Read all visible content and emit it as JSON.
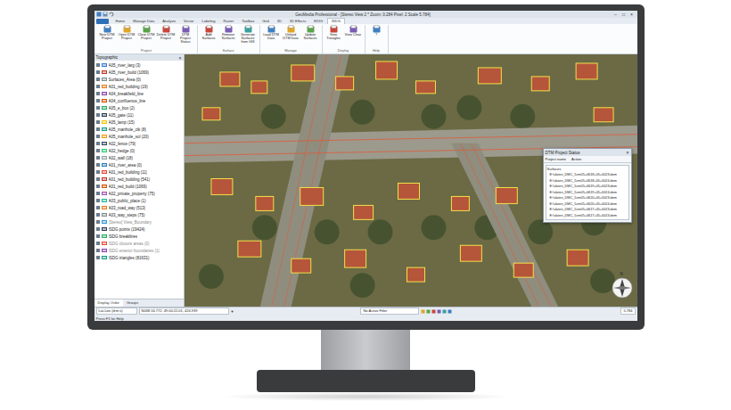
{
  "window": {
    "title": "GeoMedia Professional - [Stereo View 2 * Zoom: 0.284 Pixel: 2 Scale 5.784]",
    "controls": [
      "–",
      "□",
      "×"
    ]
  },
  "ribbon_tabs": [
    {
      "label": "Home",
      "selected": false
    },
    {
      "label": "Manage Data",
      "selected": false
    },
    {
      "label": "Analysis",
      "selected": false
    },
    {
      "label": "Vector",
      "selected": false
    },
    {
      "label": "Labeling",
      "selected": false
    },
    {
      "label": "Raster",
      "selected": false
    },
    {
      "label": "Toolbox",
      "selected": false
    },
    {
      "label": "Grid",
      "selected": false
    },
    {
      "label": "3D",
      "selected": false
    },
    {
      "label": "3D Effects",
      "selected": false
    },
    {
      "label": "EDIG",
      "selected": false
    },
    {
      "label": "ISDG",
      "selected": true
    }
  ],
  "ribbon_groups": [
    {
      "label": "Project",
      "buttons": [
        "New DTM Project",
        "Open DTM Project",
        "Close DTM Project",
        "Delete DTM Project",
        "DTM Project Status"
      ]
    },
    {
      "label": "Surface",
      "buttons": [
        "Add Surfaces",
        "Remove Surfaces",
        "Generate Surfaces from GIS"
      ]
    },
    {
      "label": "Manage",
      "buttons": [
        "Load DTM Data",
        "Unload DTM Data",
        "Update Surfaces"
      ]
    },
    {
      "label": "Display",
      "buttons": [
        "View Triangles",
        "View Clear"
      ]
    },
    {
      "label": "Help",
      "buttons": [
        "?"
      ]
    }
  ],
  "legend": {
    "title": "Topographic",
    "close": "×",
    "items": [
      {
        "label": "A05_river_larg (3)",
        "checked": true,
        "disabled": false,
        "color": "#3a7bd5"
      },
      {
        "label": "A05_river_build (1069)",
        "checked": true,
        "disabled": false,
        "color": "#c0392b"
      },
      {
        "label": "Surfaces_Area (0)",
        "checked": true,
        "disabled": false,
        "color": "#7f8c8d"
      },
      {
        "label": "A01_red_building (19)",
        "checked": true,
        "disabled": false,
        "color": "#e67e22"
      },
      {
        "label": "A04_breakfield_line",
        "checked": true,
        "disabled": false,
        "color": "#8e44ad"
      },
      {
        "label": "A04_confluence_line",
        "checked": true,
        "disabled": false,
        "color": "#d35400"
      },
      {
        "label": "A05_e_box (2)",
        "checked": true,
        "disabled": false,
        "color": "#27ae60"
      },
      {
        "label": "A05_gate (11)",
        "checked": true,
        "disabled": false,
        "color": "#2c3e50"
      },
      {
        "label": "A05_lamp (15)",
        "checked": true,
        "disabled": false,
        "color": "#f1c40f"
      },
      {
        "label": "A05_manhole_cik (8)",
        "checked": true,
        "disabled": false,
        "color": "#16a085"
      },
      {
        "label": "A05_manhole_sol (20)",
        "checked": true,
        "disabled": false,
        "color": "#f39c12"
      },
      {
        "label": "A02_fence (79)",
        "checked": true,
        "disabled": false,
        "color": "#34495e"
      },
      {
        "label": "A02_hedge (0)",
        "checked": true,
        "disabled": false,
        "color": "#2ecc71"
      },
      {
        "label": "A02_wall (18)",
        "checked": true,
        "disabled": false,
        "color": "#95a5a6"
      },
      {
        "label": "A01_river_area (0)",
        "checked": true,
        "disabled": false,
        "color": "#2980b9"
      },
      {
        "label": "A01_red_building (11)",
        "checked": true,
        "disabled": false,
        "color": "#e74c3c"
      },
      {
        "label": "A01_red_building (541)",
        "checked": true,
        "disabled": false,
        "color": "#c0392b"
      },
      {
        "label": "A01_red_build (1069)",
        "checked": true,
        "disabled": false,
        "color": "#d35400"
      },
      {
        "label": "A02_private_property (75)",
        "checked": true,
        "disabled": false,
        "color": "#9b59b6"
      },
      {
        "label": "A03_public_place (1)",
        "checked": true,
        "disabled": false,
        "color": "#1abc9c"
      },
      {
        "label": "A03_road_way (513)",
        "checked": true,
        "disabled": false,
        "color": "#e67e22"
      },
      {
        "label": "A03_way_steps (75)",
        "checked": true,
        "disabled": false,
        "color": "#7f8c8d"
      },
      {
        "label": "[Stereo] View_Boundary",
        "checked": true,
        "disabled": true,
        "color": "#3498db"
      },
      {
        "label": "ISDG points (19424)",
        "checked": true,
        "disabled": false,
        "color": "#2c3e50"
      },
      {
        "label": "ISDG breaklines",
        "checked": true,
        "disabled": false,
        "color": "#27ae60"
      },
      {
        "label": "ISDG closure areas (0)",
        "checked": true,
        "disabled": true,
        "color": "#e74c3c"
      },
      {
        "label": "ISDG exterior boundaries (1)",
        "checked": true,
        "disabled": true,
        "color": "#8e44ad"
      },
      {
        "label": "ISDG triangles (81631)",
        "checked": true,
        "disabled": false,
        "color": "#16a085"
      }
    ]
  },
  "legend_tabs": [
    {
      "label": "Display Order",
      "selected": true
    },
    {
      "label": "Groups",
      "selected": false
    }
  ],
  "dialog": {
    "title": "DTM Project Status",
    "close": "×",
    "columns": [
      "Project name",
      "Action"
    ],
    "group": "Surfaces",
    "files": [
      "E:\\ulaten_DMC_5cm05+0618+05+0023.dem",
      "E:\\ulaten_DMC_5cm05+0618+05+0024.dem",
      "E:\\ulaten_DMC_5cm05+0619+05+0023.dem",
      "E:\\ulaten_DMC_5cm05+0619+05+0024.dem",
      "E:\\ulaten_DMC_5cm05+0620+05+0023.dem",
      "E:\\ulaten_DMC_5cm05+0620+05+0024.dem",
      "E:\\ulaten_DMC_5cm05+0617+05+0023.dem",
      "E:\\ulaten_DMC_5cm05+0617+05+0024.dem"
    ]
  },
  "north_arrow": "N",
  "status_bar": {
    "coordinate_system": "Lat-Lon (d:m:s)",
    "coordinates": "N038:16.772, 49:00:22.01, 424.939",
    "dropdown": "▼",
    "filter": "No Active Filter",
    "scale": "5.784",
    "help": "Press F1 for Help"
  }
}
